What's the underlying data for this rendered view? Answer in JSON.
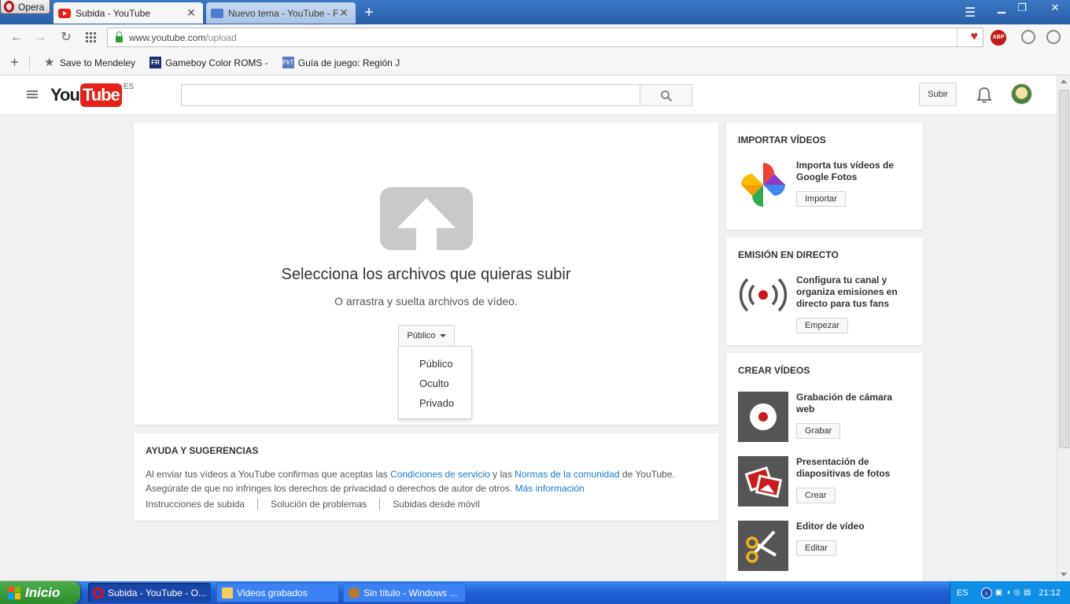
{
  "browser": {
    "menu_label": "Opera",
    "tabs": [
      {
        "title": "Subida - YouTube",
        "active": true
      },
      {
        "title": "Nuevo tema - YouTube - For",
        "active": false
      }
    ],
    "url_host": "www.youtube.com",
    "url_path": "/upload",
    "bookmarks": [
      {
        "label": "Save to Mendeley",
        "icon": "star-icon"
      },
      {
        "label": "Gameboy Color ROMS -",
        "icon_text": "FR"
      },
      {
        "label": "Guía de juego: Región J",
        "icon_text": "PkT"
      }
    ],
    "abp_label": "ABP"
  },
  "youtube": {
    "logo_you": "You",
    "logo_tube": "Tube",
    "logo_region": "ES",
    "search_placeholder": "",
    "upload_button": "Subir",
    "main": {
      "title": "Selecciona los archivos que quieras subir",
      "subtitle": "O arrastra y suelta archivos de vídeo.",
      "privacy_selected": "Público",
      "privacy_options": [
        "Público",
        "Oculto",
        "Privado"
      ]
    },
    "help": {
      "heading": "AYUDA Y SUGERENCIAS",
      "text_1": "Al enviar tus vídeos a YouTube confirmas que aceptas las ",
      "link_terms": "Condiciones de servicio",
      "text_2": " y las ",
      "link_guidelines": "Normas de la comunidad",
      "text_3": " de YouTube.",
      "text_4": "Asegúrate de que no infringes los derechos de privacidad o derechos de autor de otros. ",
      "link_more": "Más información",
      "links": [
        "Instrucciones de subida",
        "Solución de problemas",
        "Subidas desde móvil"
      ]
    },
    "import": {
      "heading": "IMPORTAR VÍDEOS",
      "text": "Importa tus vídeos de Google Fotos",
      "button": "Importar"
    },
    "live": {
      "heading": "EMISIÓN EN DIRECTO",
      "text": "Configura tu canal y organiza emisiones en directo para tus fans",
      "button": "Empezar"
    },
    "create": {
      "heading": "CREAR VÍDEOS",
      "items": [
        {
          "text": "Grabación de cámara web",
          "button": "Grabar"
        },
        {
          "text": "Presentación de diapositivas de fotos",
          "button": "Crear"
        },
        {
          "text": "Editor de vídeo",
          "button": "Editar"
        }
      ]
    }
  },
  "taskbar": {
    "start_label": "Inicio",
    "tasks": [
      "Subida - YouTube - O...",
      "Videos grabados",
      "Sin título - Windows ..."
    ],
    "language": "ES",
    "clock": "21:12"
  },
  "colors": {
    "youtube_red": "#e62117",
    "link_blue": "#167ac6"
  }
}
